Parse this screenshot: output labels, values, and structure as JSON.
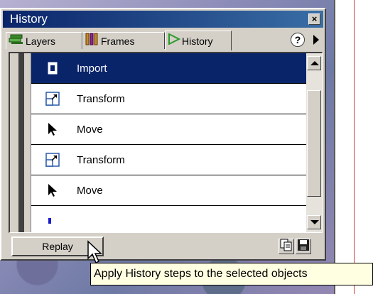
{
  "panel": {
    "title": "History",
    "close_label": "×",
    "help_label": "?"
  },
  "tabs": [
    {
      "label": "Layers",
      "icon": "layers-icon"
    },
    {
      "label": "Frames",
      "icon": "frames-icon"
    },
    {
      "label": "History",
      "icon": "history-play-icon",
      "active": true
    }
  ],
  "history_steps": [
    {
      "label": "Import",
      "icon": "import-icon",
      "selected": true
    },
    {
      "label": "Transform",
      "icon": "transform-icon"
    },
    {
      "label": "Move",
      "icon": "arrow-cursor-icon"
    },
    {
      "label": "Transform",
      "icon": "transform-icon"
    },
    {
      "label": "Move",
      "icon": "arrow-cursor-icon"
    }
  ],
  "footer": {
    "replay_label": "Replay",
    "copy_icon": "copy-steps-icon",
    "save_icon": "save-command-icon"
  },
  "tooltip": {
    "text": "Apply History steps to the selected objects"
  },
  "colors": {
    "title_bar": "#0a246a",
    "selected_row": "#0a246a",
    "panel_bg": "#d4d0c8",
    "tooltip_bg": "#ffffe1"
  }
}
